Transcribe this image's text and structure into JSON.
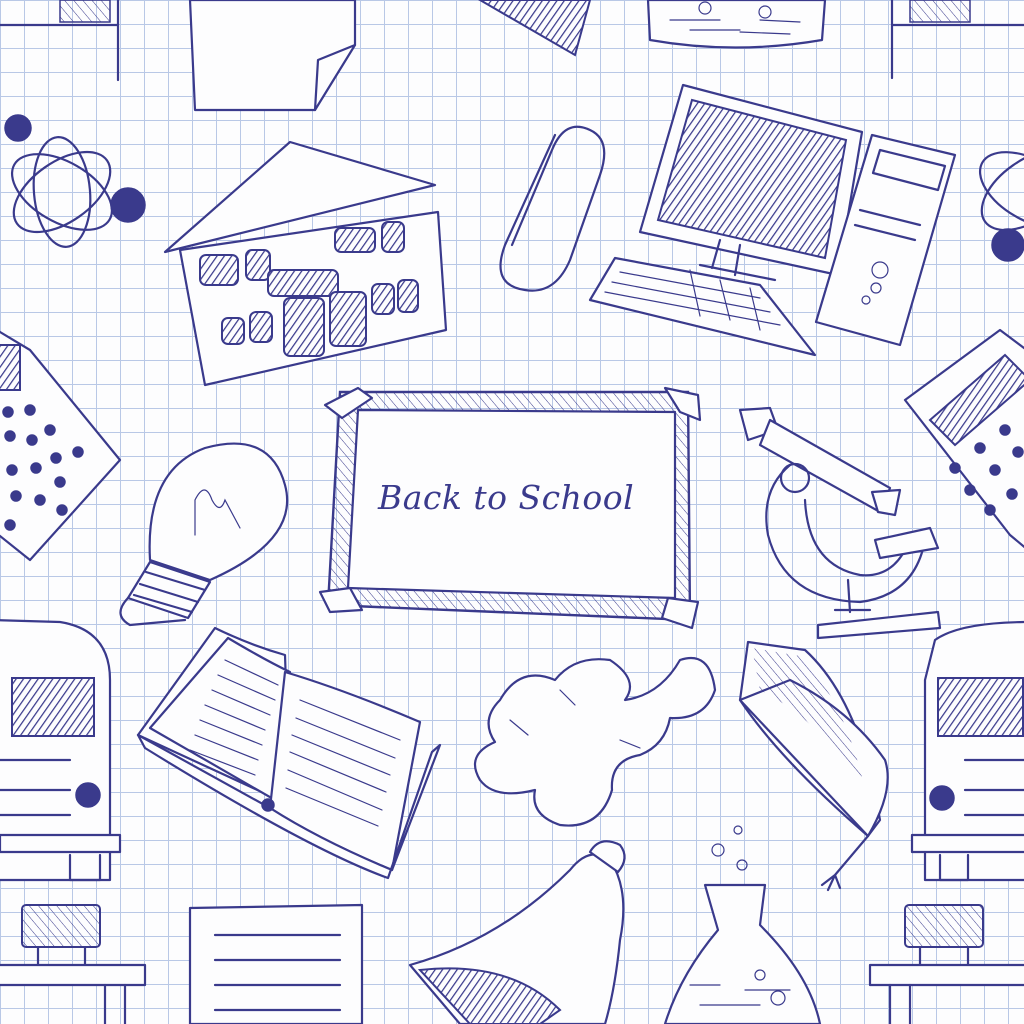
{
  "blackboard": {
    "text": "Back to School"
  },
  "colors": {
    "ink": "#3a3a8c",
    "grid": "#b9c8e6",
    "paper": "#fdfdfe"
  }
}
